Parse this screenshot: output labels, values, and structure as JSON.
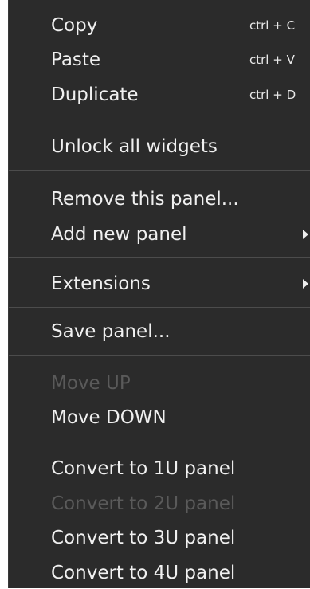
{
  "menu": {
    "copy": {
      "label": "Copy",
      "shortcut": "ctrl + C"
    },
    "paste": {
      "label": "Paste",
      "shortcut": "ctrl + V"
    },
    "duplicate": {
      "label": "Duplicate",
      "shortcut": "ctrl + D"
    },
    "unlock": {
      "label": "Unlock all widgets"
    },
    "remove": {
      "label": "Remove this panel..."
    },
    "add": {
      "label": "Add new panel",
      "icon": "submenu-arrow-icon"
    },
    "extensions": {
      "label": "Extensions",
      "icon": "submenu-arrow-icon"
    },
    "save": {
      "label": "Save panel..."
    },
    "move_up": {
      "label": "Move UP",
      "enabled": false
    },
    "move_down": {
      "label": "Move DOWN",
      "enabled": true
    },
    "convert_1u": {
      "label": "Convert to 1U panel",
      "enabled": true
    },
    "convert_2u": {
      "label": "Convert to 2U panel",
      "enabled": false
    },
    "convert_3u": {
      "label": "Convert to 3U panel",
      "enabled": true
    },
    "convert_4u": {
      "label": "Convert to 4U panel",
      "enabled": true
    }
  },
  "colors": {
    "background": "#2b2b2b",
    "text": "#f0f0f0",
    "disabled_text": "#5a5a5a",
    "separator": "#4c4c4c"
  }
}
